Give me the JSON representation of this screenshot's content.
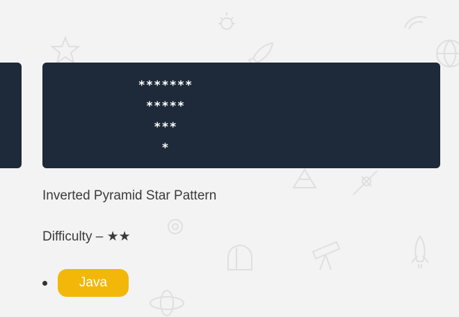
{
  "pattern": {
    "lines": [
      "*******",
      "*****",
      "***",
      "*"
    ]
  },
  "title": "Inverted Pyramid Star Pattern",
  "difficulty": {
    "label": "Difficulty",
    "separator": " – ",
    "stars": "★★"
  },
  "tags": [
    {
      "label": "Java",
      "color": "#f3b70a"
    }
  ],
  "colors": {
    "background": "#f3f3f3",
    "card": "#1e2939",
    "text": "#3a3a3a",
    "tag": "#f3b70a"
  }
}
